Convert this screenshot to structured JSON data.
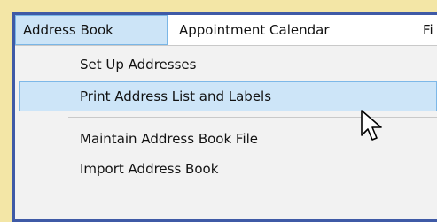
{
  "menubar": {
    "items": [
      {
        "label": "Address Book"
      },
      {
        "label": "Appointment Calendar"
      },
      {
        "label": "Fi"
      }
    ]
  },
  "dropdown": {
    "items": [
      {
        "label": "Set Up Addresses"
      },
      {
        "label": "Print Address List and Labels"
      },
      {
        "label": "Maintain Address Book File"
      },
      {
        "label": "Import Address Book"
      }
    ]
  },
  "cursor": {
    "icon": "arrow-pointer-icon"
  },
  "colors": {
    "background": "#f3e6a6",
    "frame": "#3f5aa6",
    "highlight": "#cde5f8",
    "highlight_border": "#7db8e8"
  }
}
